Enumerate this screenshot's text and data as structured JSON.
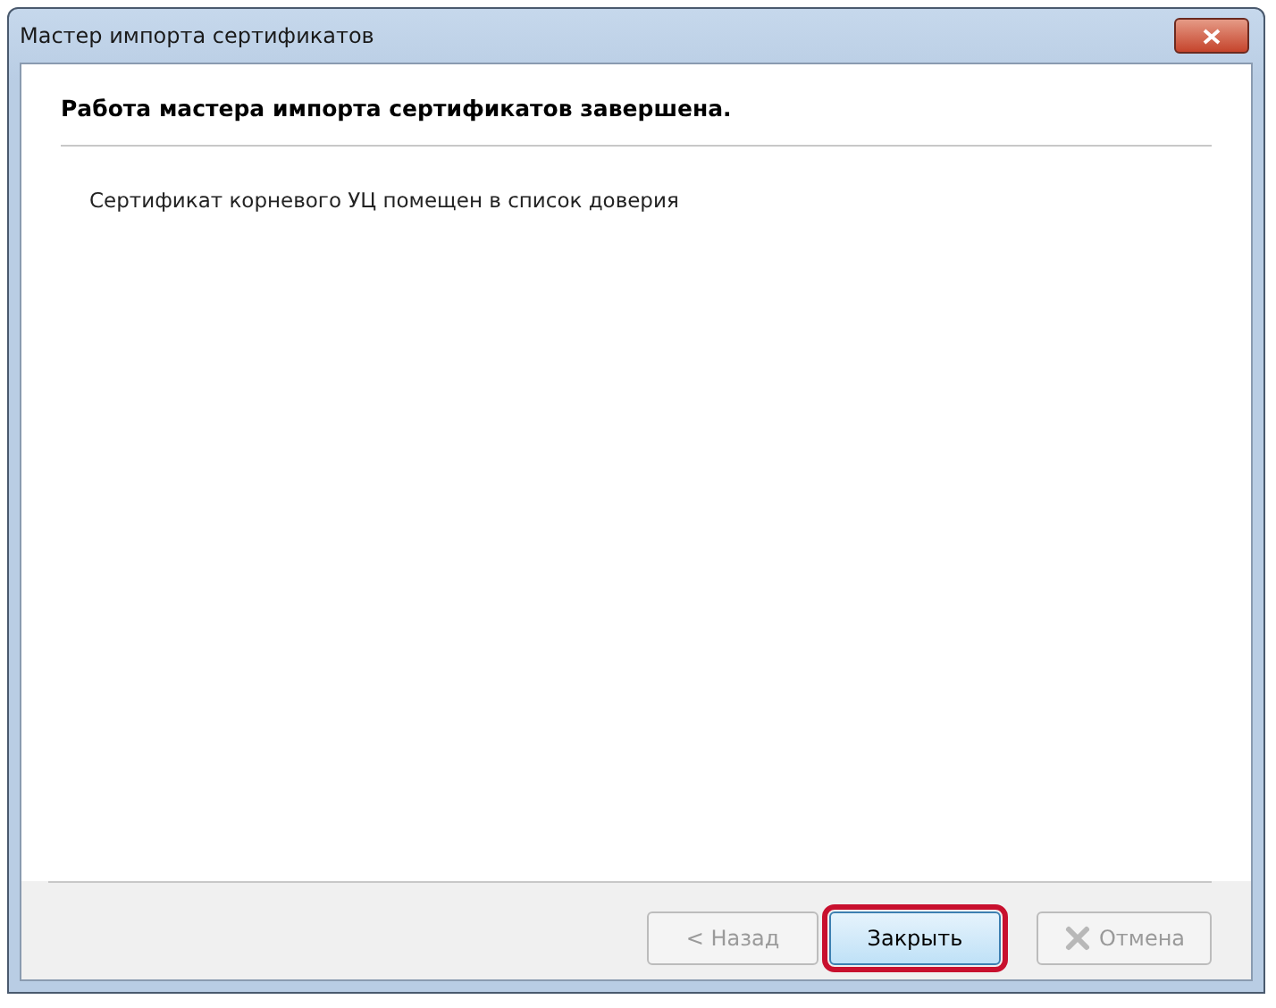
{
  "window": {
    "title": "Мастер импорта сертификатов"
  },
  "heading": "Работа мастера импорта сертификатов завершена.",
  "message": "Сертификат корневого УЦ помещен в список доверия",
  "buttons": [
    {
      "kind": "back",
      "label": "< Назад",
      "disabled": true,
      "highlighted": false
    },
    {
      "kind": "close",
      "label": "Закрыть",
      "disabled": false,
      "highlighted": true
    },
    {
      "kind": "cancel",
      "label": "Отмена",
      "disabled": true,
      "highlighted": false
    }
  ]
}
